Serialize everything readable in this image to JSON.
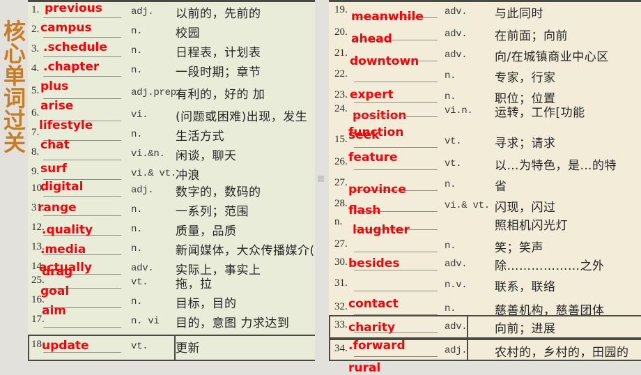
{
  "title": {
    "vertical_text": "核心单词过关"
  },
  "colors": {
    "answer_red": "#fb0007",
    "title_orange": "#c87d25",
    "left_table_bg": "#e9ecd9",
    "right_table_bg": "#f3ecd9",
    "page_bg": "#e3e1dc",
    "border": "#4a4a42"
  },
  "left_table": {
    "rows": [
      {
        "num": "1.",
        "word": "previous",
        "pos": "adj.",
        "cn": "以前的，先前的"
      },
      {
        "num": "2.",
        "word": "campus",
        "pos": "n.",
        "cn": "校园"
      },
      {
        "num": "3.",
        "word": ".schedule",
        "pos": "n.",
        "cn": "日程表，计划表"
      },
      {
        "num": "4.",
        "word": ".chapter",
        "pos": "n.",
        "cn": "一段时期；章节"
      },
      {
        "num": "5.",
        "word": "plus",
        "pos": "adj.prep.",
        "cn": "有利的，好的    加"
      },
      {
        "num": "6.",
        "word": "arise",
        "pos": "vi.",
        "cn": "(问题或困难)出现，发生"
      },
      {
        "num": "7.",
        "word": "lifestyle",
        "pos": "n.",
        "cn": "生活方式"
      },
      {
        "num": "8.",
        "word": "chat",
        "pos": "vi.&n.",
        "cn": "闲谈，聊天"
      },
      {
        "num": "9.",
        "word": "surf",
        "pos": "vi.& vt.",
        "cn": "冲浪"
      },
      {
        "num": "10.",
        "word": "digital",
        "pos": "adj.",
        "cn": "数字的，数码的"
      },
      {
        "num": "31.",
        "word": "range",
        "pos": "n.",
        "cn": "一系列；范围"
      },
      {
        "num": "12.",
        "word": ".quality",
        "pos": "n.",
        "cn": "质量，品质"
      },
      {
        "num": "13.",
        "word": ".media",
        "pos": "n.",
        "cn": "新闻媒体，大众传播媒介("
      },
      {
        "num": "14.",
        "word": "actually",
        "pos": "adv.",
        "cn": "实际上，事实上"
      },
      {
        "num": "25.",
        "word": "drag",
        "pos": "vt.",
        "cn": "拖，拉"
      },
      {
        "num": "16.",
        "word": "goal",
        "pos": "n.",
        "cn": "目标，目的"
      },
      {
        "num": "17.",
        "word": "aim",
        "pos": "n. vi",
        "cn": "目的，意图  力求达到"
      },
      {
        "num": "18",
        "word": "update",
        "pos": "vt.",
        "cn": "更新"
      }
    ]
  },
  "right_table": {
    "rows": [
      {
        "num": "19.",
        "word": "meanwhile",
        "pos": "adv.",
        "cn": "与此同时"
      },
      {
        "num": "20.",
        "word": "ahead",
        "pos": "adv.",
        "cn": "在前面；向前"
      },
      {
        "num": "21.",
        "word": "downtown",
        "pos": "adv.",
        "cn": "向/在城镇商业中心区"
      },
      {
        "num": "22.",
        "word": "expert",
        "pos": "n.",
        "cn": "专家，行家"
      },
      {
        "num": "23.",
        "word": " position",
        "pos": "n.",
        "cn": "职位；位置"
      },
      {
        "num": "24.",
        "word": "function",
        "pos": "vi.n.",
        "cn": "运转，工作[功能"
      },
      {
        "num": "15.",
        "word": "seek",
        "pos": "vt.",
        "cn": "寻求；请求"
      },
      {
        "num": "26.",
        "word": "feature",
        "pos": "vt.",
        "cn": "以…为特色，是…的特"
      },
      {
        "num": "27.",
        "word": "province",
        "pos": "n.",
        "cn": "省"
      },
      {
        "num": "28.",
        "word": "flash",
        "pos": "vi.& vt.",
        "cn": "闪现，闪过"
      },
      {
        "num": "n.",
        "word": "laughter",
        "pos": "",
        "cn": "照相机闪光灯"
      },
      {
        "num": "27.",
        "word": "besides",
        "pos": "n.",
        "cn": "笑；笑声"
      },
      {
        "num": "30.",
        "word": "",
        "pos": "adv.",
        "cn": "除………………之外"
      },
      {
        "num": "31.",
        "word": "contact",
        "pos": "n.v.",
        "cn": "联系，联络"
      },
      {
        "num": "32.",
        "word": "charity",
        "pos": "n.",
        "cn": "慈善机构，慈善团体"
      },
      {
        "num": "33.",
        "word": ".forward",
        "pos": "adv.",
        "cn": "向前；进展"
      },
      {
        "num": "34.",
        "word": "rural",
        "pos": "adj.",
        "cn": "农村的，乡村的，田园的"
      }
    ]
  }
}
